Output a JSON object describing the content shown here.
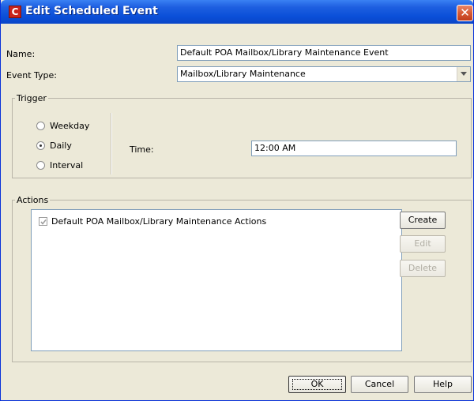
{
  "window": {
    "title": "Edit Scheduled Event",
    "icon": "app-c-icon",
    "close_symbol": "✕",
    "accent": "#0a4fd8"
  },
  "form": {
    "name_label": "Name:",
    "name_value": "Default POA Mailbox/Library Maintenance Event",
    "event_type_label": "Event Type:",
    "event_type_value": "Mailbox/Library Maintenance"
  },
  "trigger": {
    "title": "Trigger",
    "options": [
      {
        "label": "Weekday",
        "selected": false
      },
      {
        "label": "Daily",
        "selected": true
      },
      {
        "label": "Interval",
        "selected": false
      }
    ],
    "time_label": "Time:",
    "time_value": "12:00 AM"
  },
  "actions": {
    "title": "Actions",
    "items": [
      {
        "label": "Default POA Mailbox/Library Maintenance Actions",
        "checked": true
      }
    ],
    "buttons": {
      "create": "Create",
      "edit": "Edit",
      "delete": "Delete"
    }
  },
  "footer": {
    "ok": "OK",
    "cancel": "Cancel",
    "help": "Help"
  }
}
